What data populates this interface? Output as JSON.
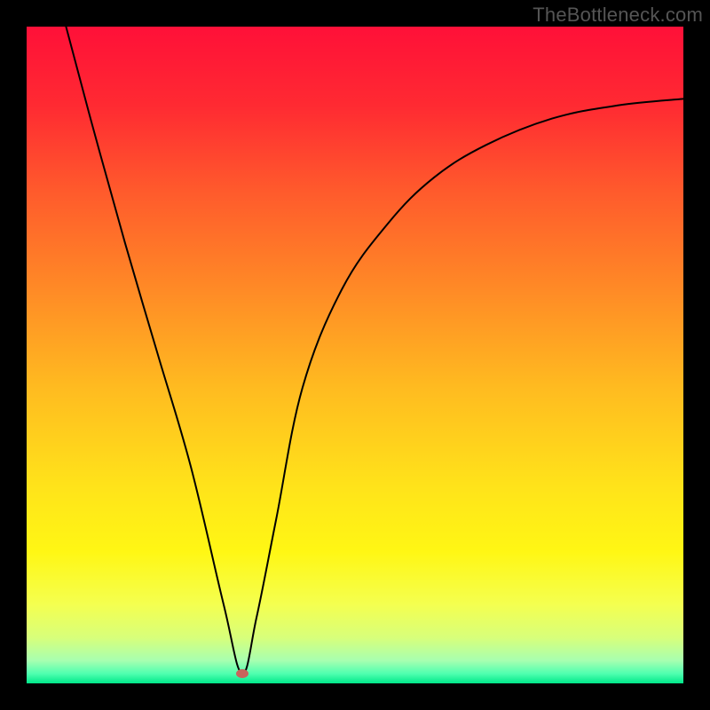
{
  "watermark": "TheBottleneck.com",
  "gradient_stops": [
    {
      "offset": 0.0,
      "color": "#ff1038"
    },
    {
      "offset": 0.12,
      "color": "#ff2a32"
    },
    {
      "offset": 0.25,
      "color": "#ff5a2c"
    },
    {
      "offset": 0.4,
      "color": "#ff8a26"
    },
    {
      "offset": 0.55,
      "color": "#ffbb20"
    },
    {
      "offset": 0.7,
      "color": "#ffe31a"
    },
    {
      "offset": 0.8,
      "color": "#fff714"
    },
    {
      "offset": 0.88,
      "color": "#f4ff50"
    },
    {
      "offset": 0.93,
      "color": "#d8ff7a"
    },
    {
      "offset": 0.965,
      "color": "#a8ffb0"
    },
    {
      "offset": 0.985,
      "color": "#50ffb0"
    },
    {
      "offset": 1.0,
      "color": "#00e88a"
    }
  ],
  "marker": {
    "x_frac": 0.328,
    "y_frac": 0.985,
    "color": "#c9635c"
  },
  "curve": {
    "stroke": "#000000",
    "stroke_width": 2
  },
  "chart_data": {
    "type": "line",
    "title": "",
    "xlabel": "",
    "ylabel": "",
    "xlim": [
      0,
      100
    ],
    "ylim": [
      0,
      100
    ],
    "series": [
      {
        "name": "bottleneck-curve",
        "x": [
          6,
          10,
          15,
          20,
          25,
          30,
          32.8,
          35,
          38,
          42,
          48,
          55,
          62,
          70,
          80,
          90,
          100
        ],
        "values": [
          100,
          85,
          67,
          50,
          33,
          12,
          1.5,
          10,
          25,
          45,
          60,
          70,
          77,
          82,
          86,
          88,
          89
        ]
      }
    ],
    "annotations": [
      {
        "name": "optimal-point",
        "x": 32.8,
        "y": 1.5
      }
    ],
    "background": "vertical-gradient-red-to-green",
    "grid": false,
    "legend": false
  }
}
